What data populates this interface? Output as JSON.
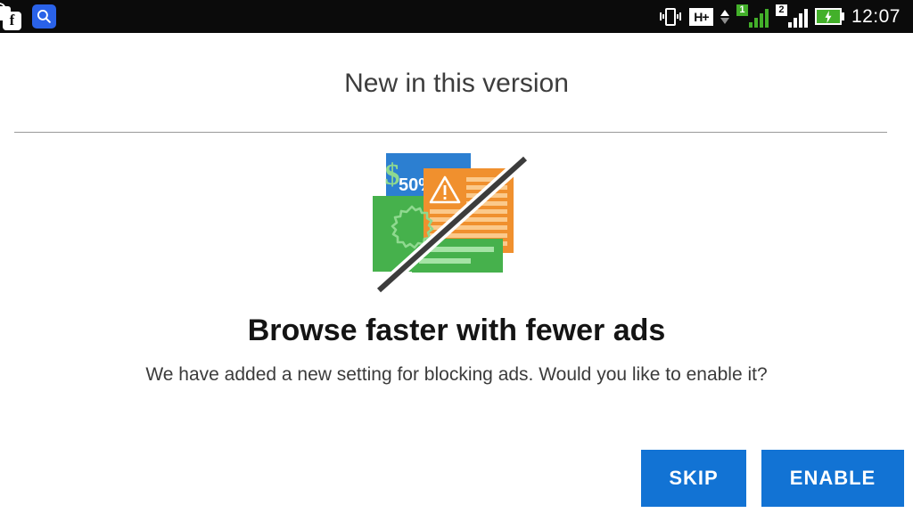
{
  "status_bar": {
    "background": "#0b0b0b",
    "left_icons": [
      {
        "name": "facebook-messenger-icon",
        "glyph": "f"
      },
      {
        "name": "search-icon",
        "glyph": "search"
      }
    ],
    "right_icons": [
      {
        "name": "vibrate-icon"
      },
      {
        "name": "hplus-network-icon",
        "label": "H+"
      },
      {
        "name": "data-transfer-arrows-icon"
      },
      {
        "name": "sim1-signal-icon",
        "sim": "1",
        "bars": 4,
        "color": "#43b02a"
      },
      {
        "name": "sim2-signal-icon",
        "sim": "2",
        "bars": 4,
        "color": "#ffffff"
      },
      {
        "name": "battery-charging-icon",
        "color": "#43b02a"
      }
    ],
    "clock": "12:07"
  },
  "page": {
    "title": "New in this version",
    "headline": "Browse faster with fewer ads",
    "subtext": "We have added a new setting for blocking ads. Would you like to enable it?"
  },
  "illustration": {
    "name": "blocked-ads-illustration",
    "discount_label": "50%",
    "currency_symbol": "$",
    "colors": {
      "blue_card": "#2c7fd1",
      "green_card": "#46b14c",
      "orange_card": "#f0902e",
      "green_lines": "#a5e3a5",
      "orange_lines": "#fbc98b",
      "slash": "#3c3c3c"
    }
  },
  "buttons": {
    "skip_label": "SKIP",
    "enable_label": "ENABLE",
    "accent_color": "#1273d4"
  }
}
